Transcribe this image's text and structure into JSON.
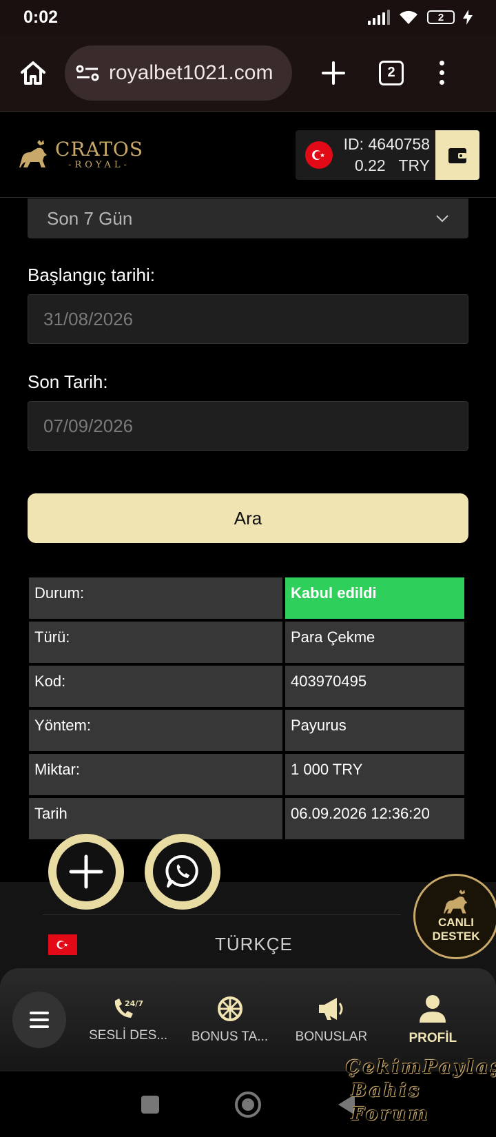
{
  "status_bar": {
    "time": "0:02",
    "battery": "2"
  },
  "browser": {
    "url": "royalbet1021.com",
    "tab_count": "2"
  },
  "site": {
    "logo_main": "CRATOS",
    "logo_sub": "-ROYAL-",
    "account_id": "ID: 4640758",
    "balance": "0.22   TRY"
  },
  "form": {
    "period_value": "Son 7 Gün",
    "start_label": "Başlangıç tarihi:",
    "start_value": "31/08/2026",
    "end_label": "Son Tarih:",
    "end_value": "07/09/2026",
    "search_label": "Ara"
  },
  "result": {
    "rows": [
      {
        "key": "Durum:",
        "value": "Kabul edildi"
      },
      {
        "key": "Türü:",
        "value": "Para Çekme"
      },
      {
        "key": "Kod:",
        "value": "403970495"
      },
      {
        "key": "Yöntem:",
        "value": "Payurus"
      },
      {
        "key": "Miktar:",
        "value": "1 000 TRY"
      },
      {
        "key": "Tarih",
        "value": "06.09.2026 12:36:20"
      }
    ]
  },
  "footer": {
    "language": "TÜRKÇE"
  },
  "live_support": {
    "line1": "CANLI",
    "line2": "DESTEK"
  },
  "bottom_nav": {
    "items": [
      {
        "label": "SESLİ DES...",
        "icon": "phone-24-7-icon"
      },
      {
        "label": "BONUS TA...",
        "icon": "wheel-icon"
      },
      {
        "label": "BONUSLAR",
        "icon": "megaphone-icon"
      },
      {
        "label": "PROFİL",
        "icon": "user-icon"
      }
    ]
  },
  "watermark": {
    "line1": "ÇekimPaylaş",
    "line2": "Bahis Forum"
  },
  "colors": {
    "accent": "#f1e4b3",
    "success": "#2fcf5b",
    "gold": "#c9a96a",
    "flag_red": "#e30a17"
  }
}
